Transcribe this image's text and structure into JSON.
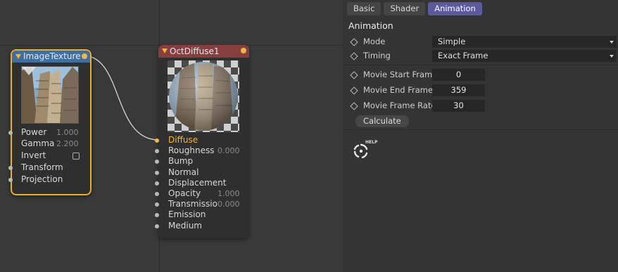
{
  "canvas": {
    "image_node": {
      "title": "ImageTexture",
      "inputs": [
        {
          "label": "Power",
          "value": "1.000"
        },
        {
          "label": "Gamma",
          "value": "2.200"
        },
        {
          "label": "Invert",
          "value": ""
        },
        {
          "label": "Transform",
          "value": ""
        },
        {
          "label": "Projection",
          "value": ""
        }
      ]
    },
    "diffuse_node": {
      "title": "OctDiffuse1",
      "inputs": [
        {
          "label": "Diffuse",
          "value": "",
          "color": "#f0b648"
        },
        {
          "label": "Roughness",
          "value": "0.000"
        },
        {
          "label": "Bump",
          "value": ""
        },
        {
          "label": "Normal",
          "value": ""
        },
        {
          "label": "Displacement",
          "value": ""
        },
        {
          "label": "Opacity",
          "value": "1.000"
        },
        {
          "label": "Transmissio",
          "value": "0.000"
        },
        {
          "label": "Emission",
          "value": ""
        },
        {
          "label": "Medium",
          "value": ""
        }
      ]
    }
  },
  "panel": {
    "tabs": [
      "Basic",
      "Shader",
      "Animation"
    ],
    "active_tab": "Animation",
    "section_title": "Animation",
    "mode": {
      "label": "Mode",
      "value": "Simple"
    },
    "timing": {
      "label": "Timing",
      "value": "Exact Frame"
    },
    "movie_start": {
      "label": "Movie Start Frame",
      "value": "0"
    },
    "movie_end": {
      "label": "Movie End Frame",
      "value": "359"
    },
    "frame_rate": {
      "label": "Movie Frame Rate",
      "value": "30"
    },
    "calculate_label": "Calculate",
    "help_label": "HELP"
  },
  "colors": {
    "accent": "#5a5a9e",
    "node_selected": "#e9ad2f",
    "image_header": "#3f6fa0",
    "diffuse_header": "#8a3d3d"
  }
}
